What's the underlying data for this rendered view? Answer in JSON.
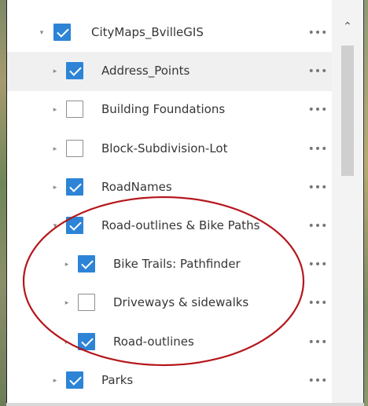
{
  "layer_list": {
    "more_label": "•••",
    "expander_collapsed": "▸",
    "expander_expanded": "▾",
    "items": [
      {
        "label": "CityMaps_BvilleGIS",
        "checked": true,
        "expanded": true,
        "level": 0,
        "highlighted": false
      },
      {
        "label": "Address_Points",
        "checked": true,
        "expanded": false,
        "level": 1,
        "highlighted": true
      },
      {
        "label": "Building Foundations",
        "checked": false,
        "expanded": false,
        "level": 1,
        "highlighted": false
      },
      {
        "label": "Block-Subdivision-Lot",
        "checked": false,
        "expanded": false,
        "level": 1,
        "highlighted": false
      },
      {
        "label": "RoadNames",
        "checked": true,
        "expanded": false,
        "level": 1,
        "highlighted": false
      },
      {
        "label": "Road-outlines & Bike Paths",
        "checked": true,
        "expanded": true,
        "level": 1,
        "highlighted": false
      },
      {
        "label": "Bike Trails: Pathfinder",
        "checked": true,
        "expanded": false,
        "level": 2,
        "highlighted": false
      },
      {
        "label": "Driveways & sidewalks",
        "checked": false,
        "expanded": false,
        "level": 2,
        "highlighted": false
      },
      {
        "label": "Road-outlines",
        "checked": true,
        "expanded": false,
        "level": 2,
        "highlighted": false
      },
      {
        "label": "Parks",
        "checked": true,
        "expanded": false,
        "level": 1,
        "highlighted": false
      }
    ]
  },
  "scrollbar": {
    "up_arrow": "⌃"
  },
  "colors": {
    "checkbox_checked": "#2d84d6",
    "annotation_ellipse": "#b5161b",
    "row_highlight": "#f0f0f0"
  },
  "icons": {
    "more": "more-horizontal-icon",
    "expander": "chevron-icon",
    "checkbox": "checkbox-icon"
  }
}
